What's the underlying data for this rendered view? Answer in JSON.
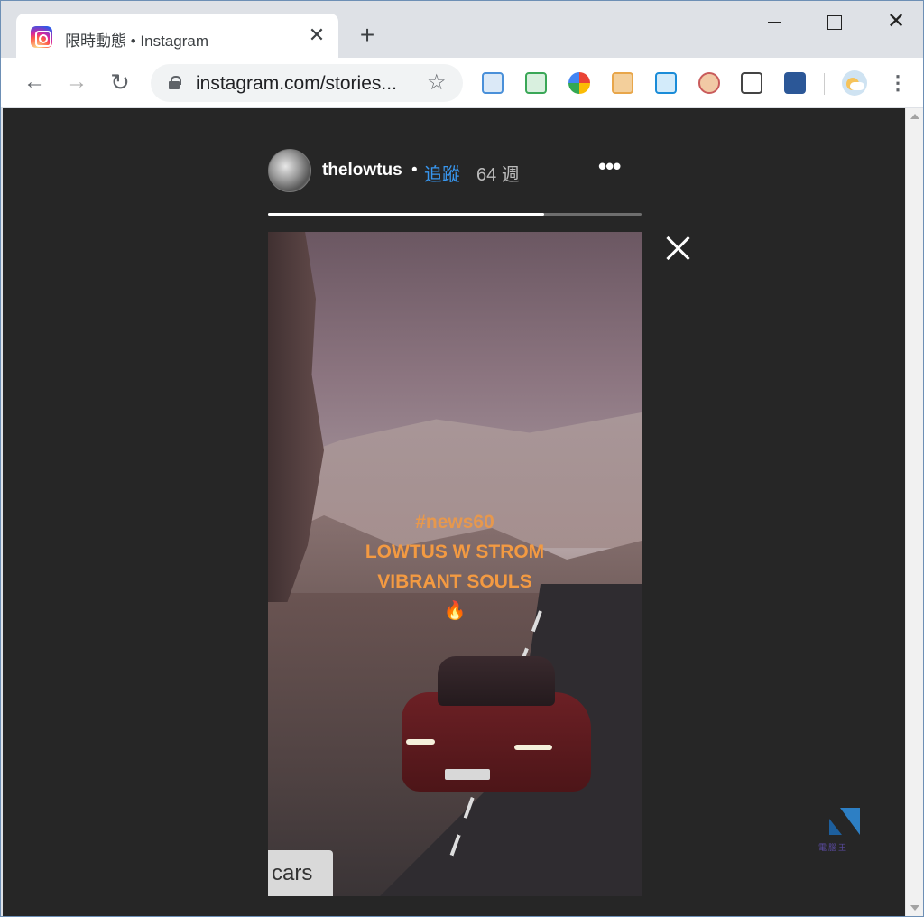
{
  "browser": {
    "tab": {
      "title": "限時動態 • Instagram",
      "close": "✕",
      "favicon": "instagram-icon"
    },
    "new_tab": "+",
    "window_controls": {
      "close": "✕"
    },
    "nav": {
      "back": "←",
      "forward": "→",
      "reload": "↻"
    },
    "address": {
      "url": "instagram.com/stories...",
      "star": "☆"
    },
    "extensions": [
      {
        "name": "clipboard-extension-icon",
        "color": "#4a90d9"
      },
      {
        "name": "checkmark-mail-extension-icon",
        "color": "#3aa757"
      },
      {
        "name": "colorful-flower-extension-icon",
        "color": "#ea4335"
      },
      {
        "name": "robot-face-extension-icon",
        "color": "#e8a64a"
      },
      {
        "name": "share-arrow-extension-icon",
        "color": "#1a8cd8"
      },
      {
        "name": "glasses-face-extension-icon",
        "color": "#c95b5b"
      },
      {
        "name": "screenshot-frame-extension-icon",
        "color": "#444444"
      },
      {
        "name": "search-magnifier-extension-icon",
        "color": "#2b5797"
      }
    ],
    "menu": "⋮"
  },
  "story": {
    "username": "thelowtus",
    "separator": "•",
    "follow": "追蹤",
    "time": "64 週",
    "more": "•••",
    "progress": 0.74,
    "overlay": {
      "hashtag": "#news60",
      "line1": "LOWTUS W STROM",
      "line2": "VIBRANT SOULS",
      "emoji": "🔥"
    },
    "sticker": "cars"
  },
  "colors": {
    "background": "#262626",
    "follow_blue": "#3897f0",
    "overlay_orange": "#f39a42"
  },
  "watermark": {
    "text": "電腦王"
  }
}
